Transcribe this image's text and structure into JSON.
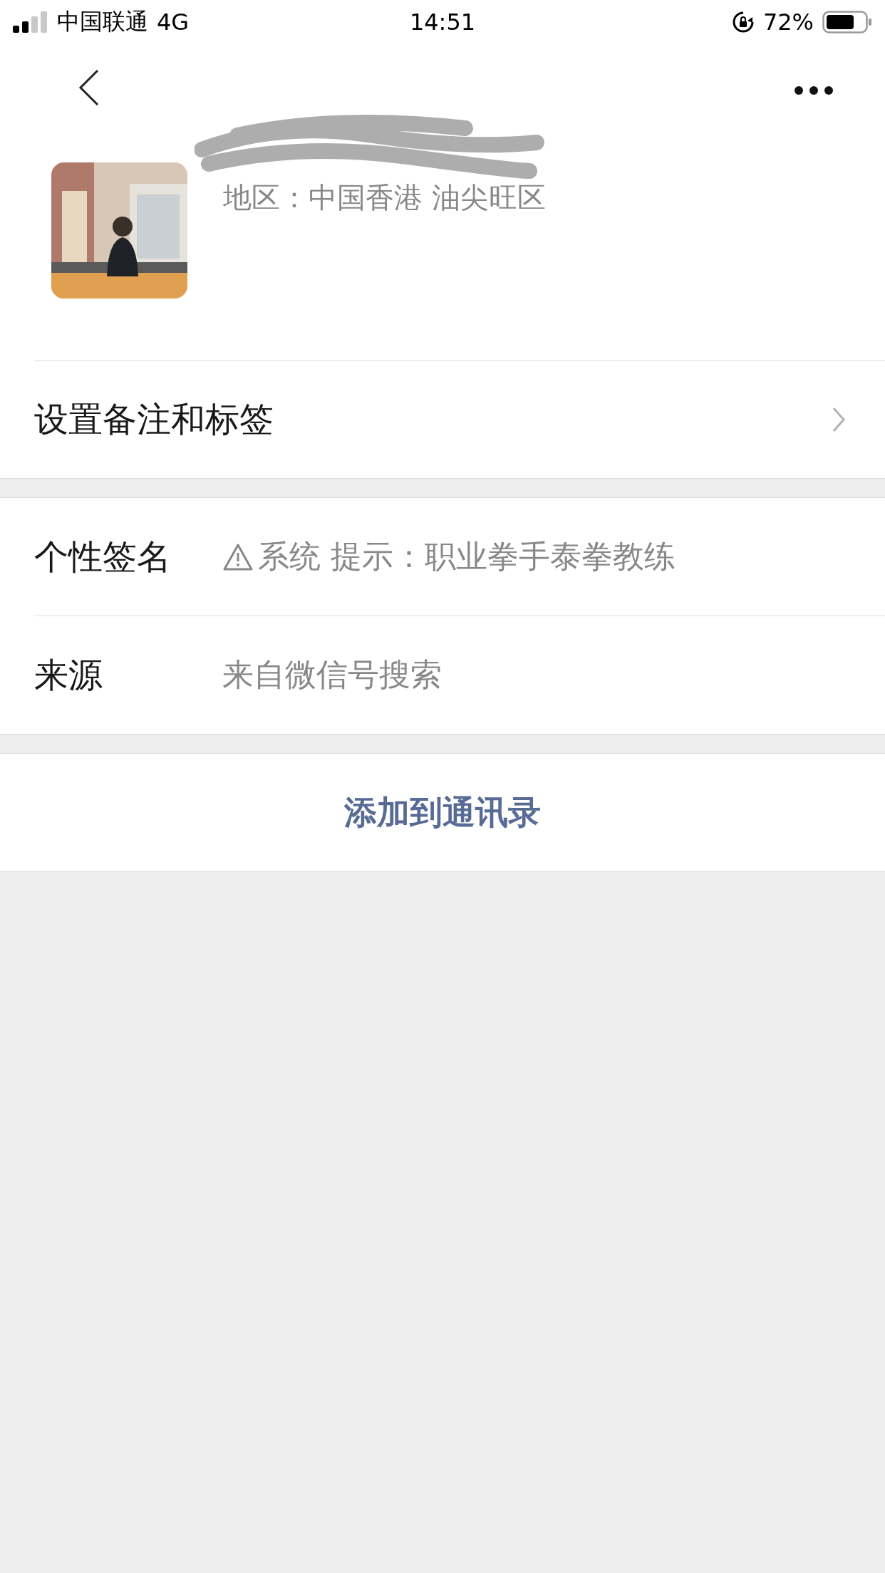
{
  "status_bar": {
    "carrier": "中国联通",
    "network": "4G",
    "time": "14:51",
    "battery": "72%"
  },
  "profile": {
    "region": "地区：中国香港 油尖旺区"
  },
  "sections": [
    {
      "rows": [
        {
          "kind": "link",
          "label": "设置备注和标签"
        }
      ]
    },
    {
      "rows": [
        {
          "kind": "field",
          "label": "个性签名",
          "value": "系统 提示：职业拳手泰拳教练",
          "warning": true
        },
        {
          "kind": "field",
          "label": "来源",
          "value": "来自微信号搜索",
          "warning": false
        }
      ]
    }
  ],
  "action": {
    "label": "添加到通讯录"
  }
}
